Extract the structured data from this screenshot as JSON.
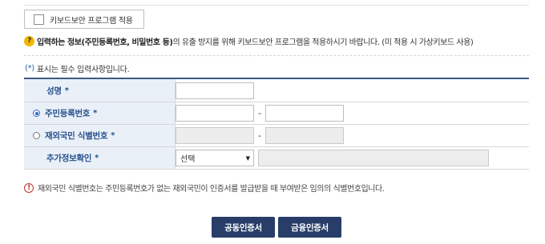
{
  "keyboard_security": {
    "label": "키보드보안 프로그램 적용",
    "checked": false
  },
  "notice": {
    "icon": "question-icon",
    "bold_text": "입력하는 정보(주민등록번호, 비밀번호 등)",
    "text": "의 유출 방지를 위해 키보드보안 프로그램을 적용하시기 바랍니다. (미 적용 시 가상키보드 사용)"
  },
  "required_note": {
    "marker": "(*)",
    "text": "표시는 필수 입력사항입니다."
  },
  "form": {
    "name": {
      "label": "성명",
      "required_mark": "*",
      "value": ""
    },
    "resident_number": {
      "label": "주민등록번호",
      "required_mark": "*",
      "selected": true,
      "front_value": "",
      "separator": "-",
      "back_value": ""
    },
    "foreigner_number": {
      "label": "재외국민 식별번호",
      "required_mark": "*",
      "selected": false,
      "front_value": "",
      "separator": "-",
      "back_value": ""
    },
    "additional_verification": {
      "label": "추가정보확인",
      "required_mark": "*",
      "select_value": "선택",
      "detail_value": ""
    }
  },
  "info": {
    "icon": "exclamation-icon",
    "text": "재외국민 식별번호는 주민등록번호가 없는 재외국민이 인증서를 발급받을 때 부여받은 임의의 식별번호입니다."
  },
  "buttons": {
    "joint_certificate": "공동인증서",
    "financial_certificate": "금융인증서"
  },
  "colors": {
    "header_text": "#27508c",
    "header_bg": "#eaf0f8",
    "table_border_top": "#3c5a82",
    "button_bg": "#283e69",
    "question_icon": "#f2b705",
    "exclamation_icon": "#c4332b"
  }
}
